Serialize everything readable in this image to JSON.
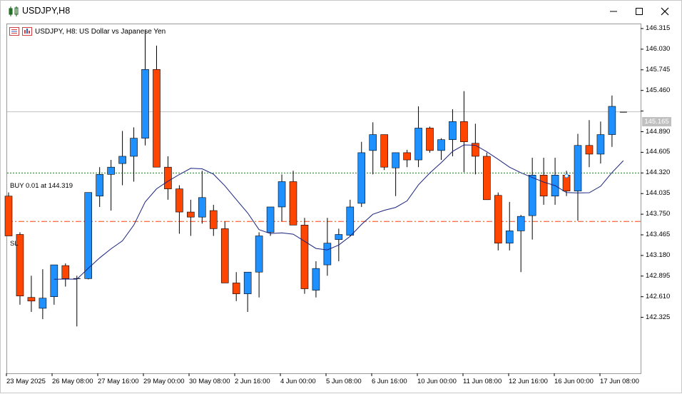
{
  "window": {
    "title": "USDJPY,H8",
    "app_icon": "chart-candles-icon",
    "controls": [
      "minimize-icon",
      "maximize-icon",
      "close-icon"
    ]
  },
  "chart_header": {
    "text": "USDJPY, H8:  US Dollar vs Japanese Yen"
  },
  "trade_lines": {
    "buy_label": "BUY 0.01 at 144.319",
    "sl_label": "SL",
    "buy_color": "#1a7a1a",
    "sl_color": "#ff4500"
  },
  "current_price": "145.165",
  "colors": {
    "bull": "#1e90ff",
    "bear": "#ff4500",
    "ma": "#1a237e"
  },
  "chart_data": {
    "type": "candlestick",
    "symbol": "USDJPY",
    "timeframe": "H8",
    "y_ticks": [
      "146.315",
      "146.030",
      "145.745",
      "145.460",
      "145.165",
      "144.890",
      "144.605",
      "144.320",
      "144.035",
      "143.750",
      "143.465",
      "143.180",
      "142.895",
      "142.610",
      "142.325"
    ],
    "x_labels": [
      "23 May 2025",
      "26 May 08:00",
      "27 May 16:00",
      "29 May 00:00",
      "30 May 08:00",
      "2 Jun 16:00",
      "4 Jun 00:00",
      "5 Jun 08:00",
      "6 Jun 16:00",
      "10 Jun 00:00",
      "11 Jun 08:00",
      "12 Jun 16:00",
      "16 Jun 00:00",
      "17 Jun 08:00"
    ],
    "buy_price": 144.319,
    "sl_price": 143.65,
    "current": 145.165,
    "candles": [
      {
        "o": 144.0,
        "h": 144.05,
        "l": 143.45,
        "c": 143.45
      },
      {
        "o": 143.47,
        "h": 143.5,
        "l": 142.5,
        "c": 142.62
      },
      {
        "o": 142.6,
        "h": 142.9,
        "l": 142.4,
        "c": 142.55
      },
      {
        "o": 142.45,
        "h": 142.99,
        "l": 142.3,
        "c": 142.59
      },
      {
        "o": 142.61,
        "h": 143.05,
        "l": 142.5,
        "c": 143.05
      },
      {
        "o": 143.04,
        "h": 143.07,
        "l": 142.75,
        "c": 142.86
      },
      {
        "o": 142.86,
        "h": 142.9,
        "l": 142.2,
        "c": 142.85
      },
      {
        "o": 142.86,
        "h": 144.05,
        "l": 142.85,
        "c": 144.05
      },
      {
        "o": 144.0,
        "h": 144.4,
        "l": 143.85,
        "c": 144.3
      },
      {
        "o": 144.3,
        "h": 144.5,
        "l": 143.8,
        "c": 144.4
      },
      {
        "o": 144.45,
        "h": 144.9,
        "l": 144.15,
        "c": 144.55
      },
      {
        "o": 144.55,
        "h": 144.95,
        "l": 144.2,
        "c": 144.8
      },
      {
        "o": 144.8,
        "h": 146.3,
        "l": 144.7,
        "c": 145.75
      },
      {
        "o": 145.75,
        "h": 146.08,
        "l": 144.4,
        "c": 144.4
      },
      {
        "o": 144.4,
        "h": 144.55,
        "l": 143.95,
        "c": 144.1
      },
      {
        "o": 144.1,
        "h": 144.15,
        "l": 143.48,
        "c": 143.78
      },
      {
        "o": 143.78,
        "h": 143.95,
        "l": 143.45,
        "c": 143.71
      },
      {
        "o": 143.71,
        "h": 144.35,
        "l": 143.62,
        "c": 143.98
      },
      {
        "o": 143.8,
        "h": 143.88,
        "l": 143.45,
        "c": 143.55
      },
      {
        "o": 143.55,
        "h": 143.65,
        "l": 142.8,
        "c": 142.8
      },
      {
        "o": 142.8,
        "h": 142.95,
        "l": 142.55,
        "c": 142.65
      },
      {
        "o": 142.65,
        "h": 142.95,
        "l": 142.4,
        "c": 142.95
      },
      {
        "o": 142.95,
        "h": 143.5,
        "l": 142.6,
        "c": 143.45
      },
      {
        "o": 143.5,
        "h": 143.85,
        "l": 143.45,
        "c": 143.85
      },
      {
        "o": 143.85,
        "h": 144.3,
        "l": 143.65,
        "c": 144.2
      },
      {
        "o": 144.2,
        "h": 144.35,
        "l": 143.6,
        "c": 143.6
      },
      {
        "o": 143.6,
        "h": 143.7,
        "l": 142.65,
        "c": 142.72
      },
      {
        "o": 142.7,
        "h": 143.1,
        "l": 142.6,
        "c": 143.0
      },
      {
        "o": 143.05,
        "h": 143.7,
        "l": 142.9,
        "c": 143.35
      },
      {
        "o": 143.4,
        "h": 143.55,
        "l": 143.1,
        "c": 143.47
      },
      {
        "o": 143.46,
        "h": 143.95,
        "l": 143.45,
        "c": 143.85
      },
      {
        "o": 143.9,
        "h": 144.75,
        "l": 143.85,
        "c": 144.6
      },
      {
        "o": 144.63,
        "h": 145.02,
        "l": 144.3,
        "c": 144.85
      },
      {
        "o": 144.85,
        "h": 144.85,
        "l": 144.36,
        "c": 144.4
      },
      {
        "o": 144.39,
        "h": 144.6,
        "l": 144.0,
        "c": 144.6
      },
      {
        "o": 144.6,
        "h": 144.64,
        "l": 144.4,
        "c": 144.5
      },
      {
        "o": 144.5,
        "h": 145.24,
        "l": 144.4,
        "c": 144.94
      },
      {
        "o": 144.94,
        "h": 144.96,
        "l": 144.6,
        "c": 144.63
      },
      {
        "o": 144.63,
        "h": 144.8,
        "l": 144.5,
        "c": 144.78
      },
      {
        "o": 144.78,
        "h": 145.2,
        "l": 144.55,
        "c": 145.03
      },
      {
        "o": 145.03,
        "h": 145.45,
        "l": 144.33,
        "c": 144.75
      },
      {
        "o": 144.73,
        "h": 145.0,
        "l": 144.3,
        "c": 144.55
      },
      {
        "o": 144.55,
        "h": 144.6,
        "l": 143.95,
        "c": 143.95
      },
      {
        "o": 144.01,
        "h": 144.05,
        "l": 143.25,
        "c": 143.35
      },
      {
        "o": 143.35,
        "h": 143.92,
        "l": 143.25,
        "c": 143.52
      },
      {
        "o": 143.52,
        "h": 143.74,
        "l": 142.95,
        "c": 143.72
      },
      {
        "o": 143.73,
        "h": 144.53,
        "l": 143.4,
        "c": 144.29
      },
      {
        "o": 144.29,
        "h": 144.53,
        "l": 143.88,
        "c": 144.0
      },
      {
        "o": 144.0,
        "h": 144.53,
        "l": 143.88,
        "c": 144.29
      },
      {
        "o": 144.29,
        "h": 144.35,
        "l": 144.0,
        "c": 144.07
      },
      {
        "o": 144.07,
        "h": 144.86,
        "l": 143.66,
        "c": 144.7
      },
      {
        "o": 144.7,
        "h": 145.05,
        "l": 144.4,
        "c": 144.58
      },
      {
        "o": 144.58,
        "h": 145.03,
        "l": 144.45,
        "c": 144.85
      },
      {
        "o": 144.85,
        "h": 145.39,
        "l": 144.68,
        "c": 145.24
      },
      {
        "o": 145.16,
        "h": 145.16,
        "l": 145.16,
        "c": 145.16
      }
    ]
  }
}
